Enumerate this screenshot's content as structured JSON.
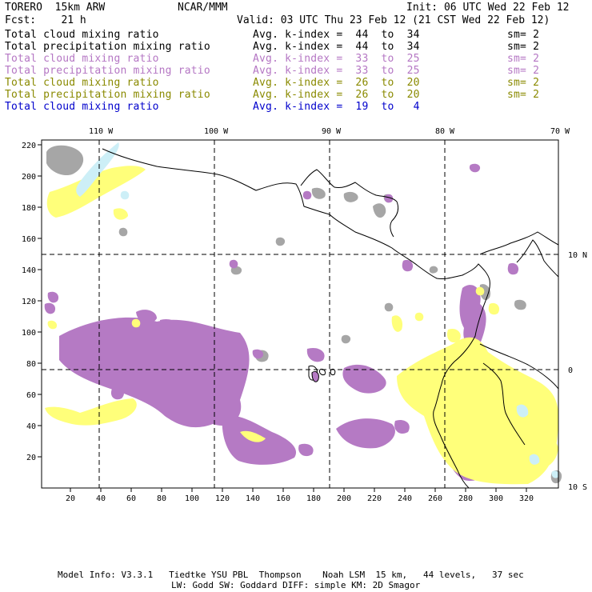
{
  "header": {
    "model": "TORERO  15km ARW",
    "center": "NCAR/MMM",
    "init": "Init: 06 UTC Wed 22 Feb 12",
    "fcst": "Fcst:    21 h",
    "valid": "Valid: 03 UTC Thu 23 Feb 12 (21 CST Wed 22 Feb 12)"
  },
  "legend": [
    {
      "field": "Total cloud mixing ratio",
      "kindex": "Avg. k-index =  44  to  34",
      "sm": "sm= 2",
      "color": "#000000"
    },
    {
      "field": "Total precipitation mixing ratio",
      "kindex": "Avg. k-index =  44  to  34",
      "sm": "sm= 2",
      "color": "#000000"
    },
    {
      "field": "Total cloud mixing ratio",
      "kindex": "Avg. k-index =  33  to  25",
      "sm": "sm= 2",
      "color": "#b577c4"
    },
    {
      "field": "Total precipitation mixing ratio",
      "kindex": "Avg. k-index =  33  to  25",
      "sm": "sm= 2",
      "color": "#b577c4"
    },
    {
      "field": "Total cloud mixing ratio",
      "kindex": "Avg. k-index =  26  to  20",
      "sm": "sm= 2",
      "color": "#8a8a00"
    },
    {
      "field": "Total precipitation mixing ratio",
      "kindex": "Avg. k-index =  26  to  20",
      "sm": "sm= 2",
      "color": "#8a8a00"
    },
    {
      "field": "Total cloud mixing ratio",
      "kindex": "Avg. k-index =  19  to   4",
      "sm": "",
      "color": "#0000cc"
    }
  ],
  "map": {
    "top_labels": [
      "110 W",
      "100 W",
      "90 W",
      "80 W",
      "70 W"
    ],
    "right_labels": [
      "10 N",
      "0",
      "10 S"
    ],
    "left_ticks": [
      "220",
      "200",
      "180",
      "160",
      "140",
      "120",
      "100",
      "80",
      "60",
      "40",
      "20"
    ],
    "bottom_ticks": [
      "20",
      "40",
      "60",
      "80",
      "100",
      "120",
      "140",
      "160",
      "180",
      "200",
      "220",
      "240",
      "260",
      "280",
      "300",
      "320"
    ],
    "colors": {
      "gray_cloud": "#a6a6a6",
      "purple_cloud": "#b57ac4",
      "yellow_cloud": "#ffff7a",
      "cyan_cloud": "#cdeff7",
      "coast": "#000000"
    }
  },
  "footer": {
    "line1": "Model Info: V3.3.1   Tiedtke YSU PBL  Thompson    Noah LSM  15 km,   44 levels,   37 sec",
    "line2": "LW: Godd SW: Goddard DIFF: simple KM: 2D Smagor"
  }
}
